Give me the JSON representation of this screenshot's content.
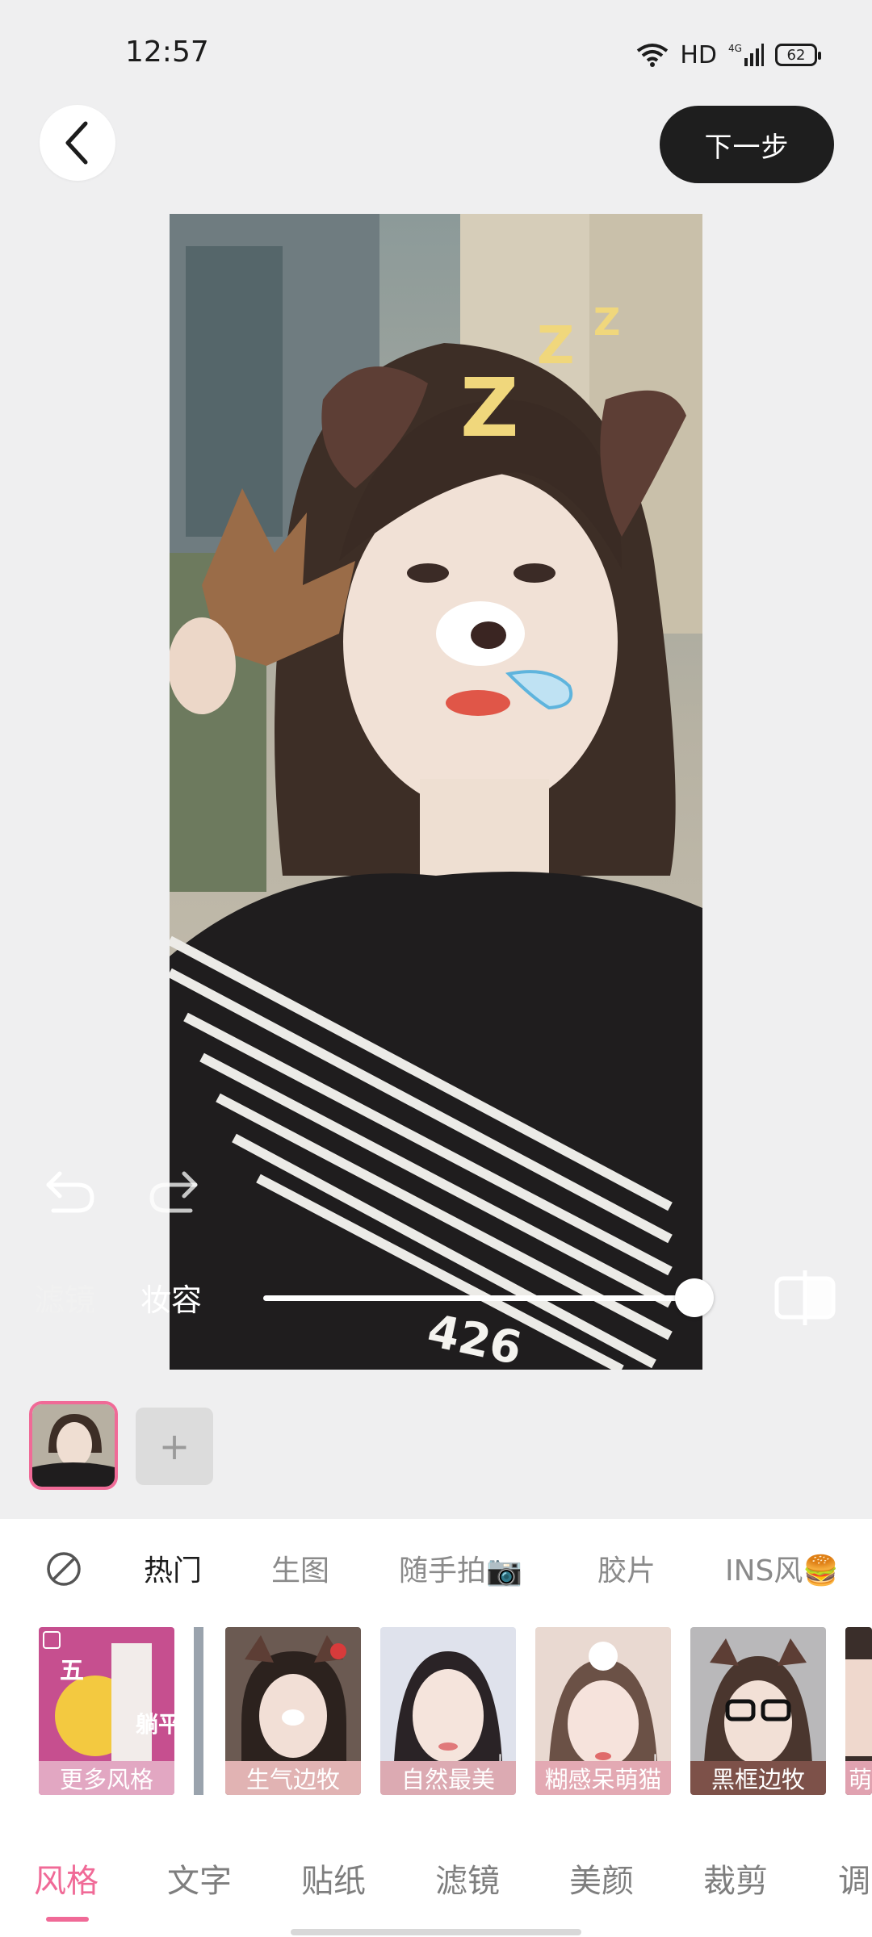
{
  "status_bar": {
    "time": "12:57",
    "network": "HD",
    "signal_type": "4G",
    "battery": "62"
  },
  "header": {
    "back_icon": "chevron-left-icon",
    "next_label": "下一步"
  },
  "editor": {
    "filter_label": "滤镜",
    "makeup_label": "妆容",
    "intensity_fraction": 1.0,
    "photo_print": "426"
  },
  "pages": {
    "add_label": "+"
  },
  "categories": {
    "none_icon": "no-style-icon",
    "tabs": [
      "热门",
      "生图",
      "随手拍📷",
      "胶片",
      "INS风🍔"
    ]
  },
  "styles": [
    {
      "label": "更多风格",
      "promo_text_1": "五",
      "promo_text_2": "躺平"
    },
    {
      "label": "生气边牧"
    },
    {
      "label": "自然最美"
    },
    {
      "label": "糊感呆萌猫"
    },
    {
      "label": "黑框边牧"
    },
    {
      "label": "萌"
    }
  ],
  "bottom_tabs": [
    "风格",
    "文字",
    "贴纸",
    "滤镜",
    "美颜",
    "裁剪",
    "调"
  ],
  "colors": {
    "accent": "#f06a97",
    "dark_button": "#1e1e1e"
  }
}
